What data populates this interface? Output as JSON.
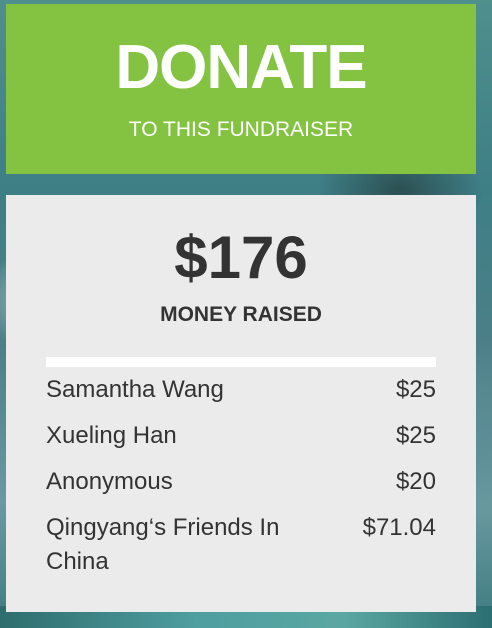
{
  "donate": {
    "title": "DONATE",
    "subtitle": "TO THIS FUNDRAISER"
  },
  "stats": {
    "amount": "$176",
    "label": "MONEY RAISED"
  },
  "donors": [
    {
      "name": "Samantha Wang",
      "amount": "$25"
    },
    {
      "name": "Xueling Han",
      "amount": "$25"
    },
    {
      "name": "Anonymous",
      "amount": "$20"
    },
    {
      "name": "Qingyang‘s Friends In China",
      "amount": "$71.04"
    }
  ],
  "colors": {
    "donate_green": "#83c341",
    "card_background": "#ebebeb",
    "text": "#333333"
  }
}
